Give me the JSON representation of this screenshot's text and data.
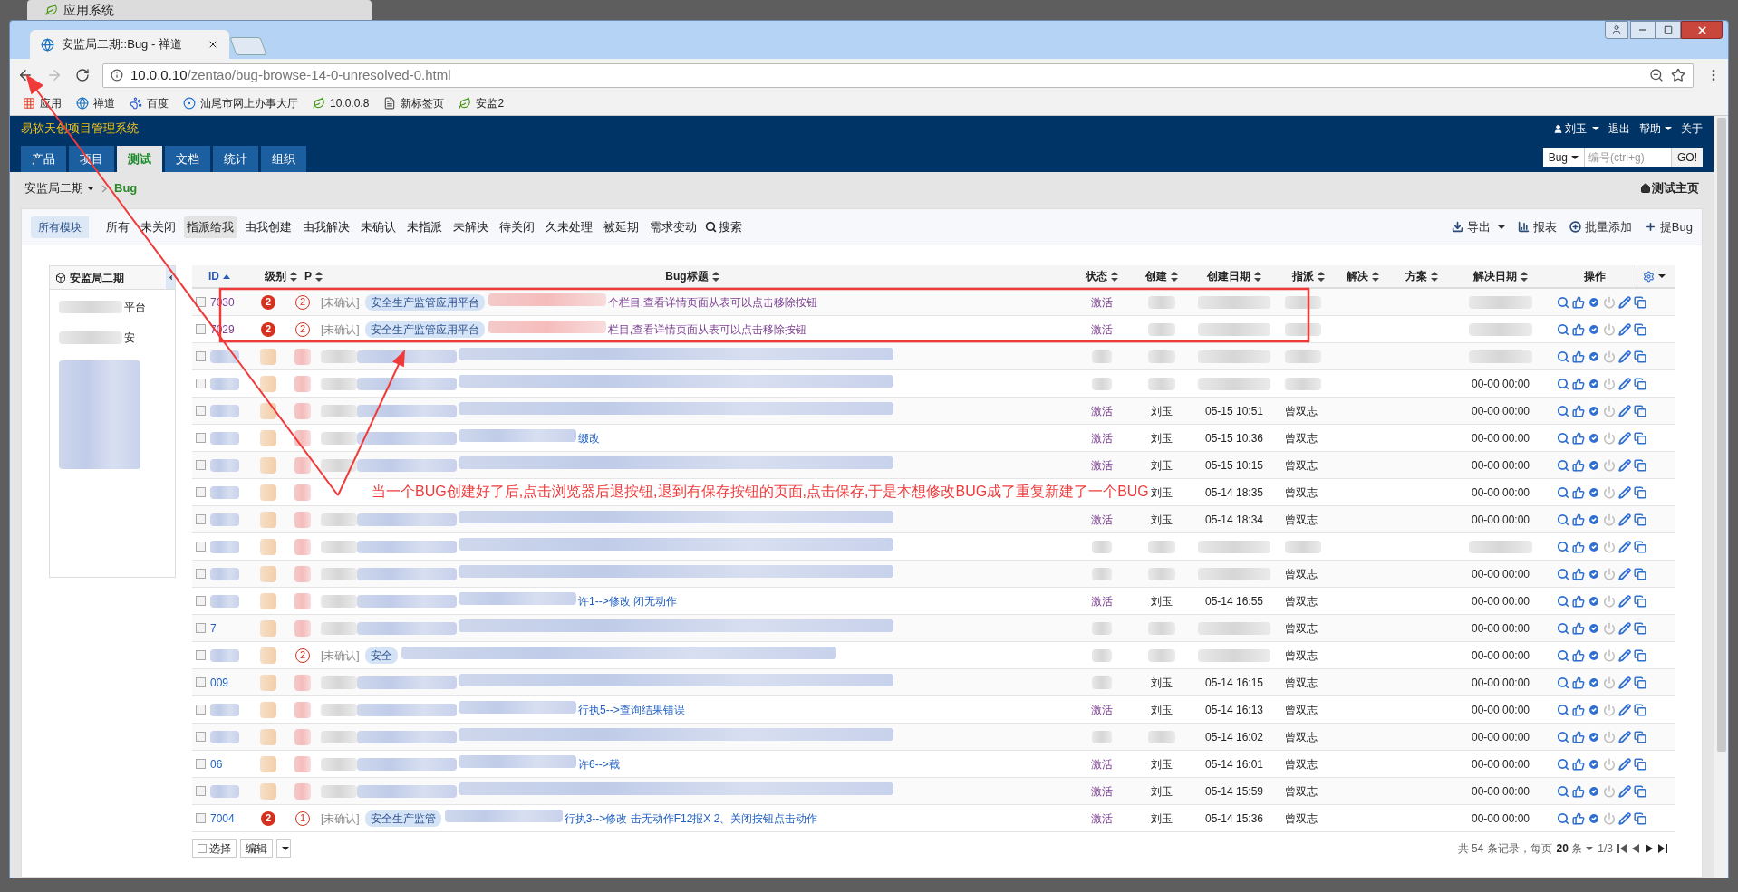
{
  "desktop_tab": {
    "title": "应用系统"
  },
  "browser": {
    "tab_title": "安监局二期::Bug - 禅道",
    "url_host": "10.0.0.10",
    "url_path": "/zentao/bug-browse-14-0-unresolved-0.html",
    "bookmarks": [
      {
        "kind": "apps",
        "label": "应用"
      },
      {
        "kind": "globe",
        "label": "禅道"
      },
      {
        "kind": "paw",
        "label": "百度"
      },
      {
        "kind": "swirl",
        "label": "汕尾市网上办事大厅"
      },
      {
        "kind": "leaf",
        "label": "10.0.0.8"
      },
      {
        "kind": "page",
        "label": "新标签页"
      },
      {
        "kind": "leaf",
        "label": "安监2"
      }
    ]
  },
  "header": {
    "brand": "易软天创项目管理系统",
    "user": "刘玉",
    "links": [
      {
        "label": "退出",
        "dropdown": false
      },
      {
        "label": "帮助",
        "dropdown": true
      },
      {
        "label": "关于",
        "dropdown": false
      }
    ],
    "nav_tabs": [
      {
        "label": "产品",
        "selected": false
      },
      {
        "label": "项目",
        "selected": false
      },
      {
        "label": "测试",
        "selected": true
      },
      {
        "label": "文档",
        "selected": false
      },
      {
        "label": "统计",
        "selected": false
      },
      {
        "label": "组织",
        "selected": false
      }
    ],
    "search": {
      "type": "Bug",
      "placeholder": "编号(ctrl+g)",
      "button": "GO!"
    }
  },
  "breadcrumb": {
    "project": "安监局二期",
    "module": "Bug",
    "home_link": "测试主页"
  },
  "filters": {
    "module_chip": "所有模块",
    "search": "搜索",
    "items": [
      {
        "label": "所有",
        "selected": false
      },
      {
        "label": "未关闭",
        "selected": false
      },
      {
        "label": "指派给我",
        "selected": true
      },
      {
        "label": "由我创建",
        "selected": false
      },
      {
        "label": "由我解决",
        "selected": false
      },
      {
        "label": "未确认",
        "selected": false
      },
      {
        "label": "未指派",
        "selected": false
      },
      {
        "label": "未解决",
        "selected": false
      },
      {
        "label": "待关闭",
        "selected": false
      },
      {
        "label": "久未处理",
        "selected": false
      },
      {
        "label": "被延期",
        "selected": false
      },
      {
        "label": "需求变动",
        "selected": false
      }
    ]
  },
  "actions": [
    {
      "kind": "export",
      "label": "导出"
    },
    {
      "kind": "report",
      "label": "报表"
    },
    {
      "kind": "batch",
      "label": "批量添加"
    },
    {
      "kind": "add",
      "label": "提Bug"
    }
  ],
  "tree": {
    "title": "安监局二期",
    "items": [
      {
        "label": "平台"
      },
      {
        "label": "安"
      }
    ]
  },
  "table": {
    "columns": [
      {
        "label": "ID",
        "sorted": true
      },
      {
        "label": "级别",
        "sorted": false
      },
      {
        "label": "P",
        "sorted": false
      },
      {
        "label": "Bug标题",
        "sorted": false
      },
      {
        "label": "状态",
        "sorted": false
      },
      {
        "label": "创建",
        "sorted": false
      },
      {
        "label": "创建日期",
        "sorted": false
      },
      {
        "label": "指派",
        "sorted": false
      },
      {
        "label": "解决",
        "sorted": false
      },
      {
        "label": "方案",
        "sorted": false
      },
      {
        "label": "解决日期",
        "sorted": false
      }
    ],
    "actions_label": "操作",
    "rows": [
      {
        "checked": false,
        "id": "7030",
        "severity": "2",
        "priority": "2",
        "confirm": "[未确认]",
        "module": "安全生产监管应用平台",
        "title": "个栏目,查看详情页面从表可以点击移除按钮",
        "visited": true,
        "status": "激活"
      },
      {
        "checked": false,
        "id": "7029",
        "severity": "2",
        "priority": "2",
        "confirm": "[未确认]",
        "module": "安全生产监管应用平台",
        "title": "栏目,查看详情页面从表可以点击移除按钮",
        "visited": true,
        "status": "激活"
      },
      {
        "checked": false
      },
      {
        "checked": false,
        "resolved": "00-00 00:00"
      },
      {
        "checked": false,
        "status": "激活",
        "creator": "刘玉",
        "created": "05-15 10:51",
        "assignee": "曾双志",
        "resolved": "00-00 00:00"
      },
      {
        "checked": false,
        "visited": false,
        "title": "缀改",
        "status": "激活",
        "creator": "刘玉",
        "created": "05-15 10:36",
        "assignee": "曾双志",
        "resolved": "00-00 00:00"
      },
      {
        "checked": false,
        "status": "激活",
        "creator": "刘玉",
        "created": "05-15 10:15",
        "assignee": "曾双志",
        "resolved": "00-00 00:00"
      },
      {
        "checked": false,
        "creator": "刘玉",
        "created": "05-14 18:35",
        "assignee": "曾双志",
        "resolved": "00-00 00:00"
      },
      {
        "checked": false,
        "status": "激活",
        "creator": "刘玉",
        "created": "05-14 18:34",
        "assignee": "曾双志",
        "resolved": "00-00 00:00"
      },
      {
        "checked": false
      },
      {
        "checked": false,
        "assignee": "曾双志",
        "resolved": "00-00 00:00"
      },
      {
        "checked": false,
        "visited": false,
        "title": "许1-->修改 闭无动作",
        "status": "激活",
        "creator": "刘玉",
        "created": "05-14 16:55",
        "assignee": "曾双志",
        "resolved": "00-00 00:00"
      },
      {
        "checked": false,
        "visited": false,
        "id": "7",
        "assignee": "曾双志",
        "resolved": "00-00 00:00"
      },
      {
        "checked": false,
        "priority": "2",
        "confirm": "[未确认]",
        "module": "安全",
        "assignee": "曾双志",
        "resolved": "00-00 00:00"
      },
      {
        "checked": false,
        "visited": false,
        "id": "009",
        "creator": "刘玉",
        "created": "05-14 16:15",
        "assignee": "曾双志",
        "resolved": "00-00 00:00"
      },
      {
        "checked": false,
        "visited": false,
        "title": "行执5-->查询结果错误",
        "status": "激活",
        "creator": "刘玉",
        "created": "05-14 16:13",
        "assignee": "曾双志",
        "resolved": "00-00 00:00"
      },
      {
        "checked": false,
        "created": "05-14 16:02",
        "assignee": "曾双志",
        "resolved": "00-00 00:00"
      },
      {
        "checked": false,
        "visited": false,
        "id": "06",
        "title": "许6-->截",
        "status": "激活",
        "creator": "刘玉",
        "created": "05-14 16:01",
        "assignee": "曾双志",
        "resolved": "00-00 00:00"
      },
      {
        "checked": false,
        "status": "激活",
        "creator": "刘玉",
        "created": "05-14 15:59",
        "assignee": "曾双志",
        "resolved": "00-00 00:00"
      },
      {
        "checked": false,
        "visited": false,
        "id": "7004",
        "severity": "2",
        "priority": "1",
        "confirm": "[未确认]",
        "module": "安全生产监管",
        "title": "行执3-->修改 击无动作F12报X 2、关闭按钮点击动作",
        "status": "激活",
        "creator": "刘玉",
        "created": "05-14 15:36",
        "assignee": "曾双志",
        "resolved": "00-00 00:00"
      }
    ]
  },
  "footer": {
    "select": "选择",
    "select_checked": false,
    "edit": "编辑",
    "total": "共 54 条记录，每页",
    "per_page": "20",
    "unit": "条",
    "pages": "1/3"
  },
  "annotation": {
    "text": "当一个BUG创建好了后,点击浏览器后退按钮,退到有保存按钮的页面,点击保存,于是本想修改BUG成了重复新建了一个BUG"
  }
}
